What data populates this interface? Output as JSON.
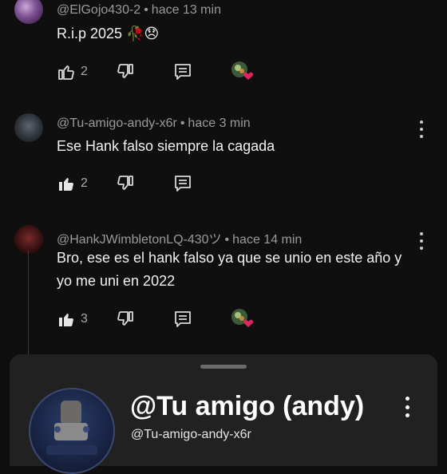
{
  "comments": [
    {
      "author": "@ElGojo430-2",
      "time": "hace 13 min",
      "text": "R.i.p 2025 🥀😞",
      "likes": "2"
    },
    {
      "author": "@Tu-amigo-andy-x6r",
      "time": "hace 3 min",
      "text": "Ese Hank falso siempre la cagada",
      "likes": "2"
    },
    {
      "author": "@HankJWimbletonLQ-430ツ",
      "time": "hace 14 min",
      "text": "Bro, ese es el hank falso ya que se unio en este año y yo me uni en 2022",
      "likes": "3"
    }
  ],
  "separator": "•",
  "channel_card": {
    "name": "@Tu amigo (andy)",
    "handle": "@Tu-amigo-andy-x6r"
  },
  "icons": {
    "like": "thumb-up-icon",
    "dislike": "thumb-down-icon",
    "reply": "reply-comment-icon",
    "creator_heart": "creator-heart-icon",
    "more": "more-vertical-icon"
  },
  "colors": {
    "background": "#0f0f0f",
    "sheet": "#212121",
    "meta_text": "#9a9a9a",
    "heart": "#e0245e"
  }
}
